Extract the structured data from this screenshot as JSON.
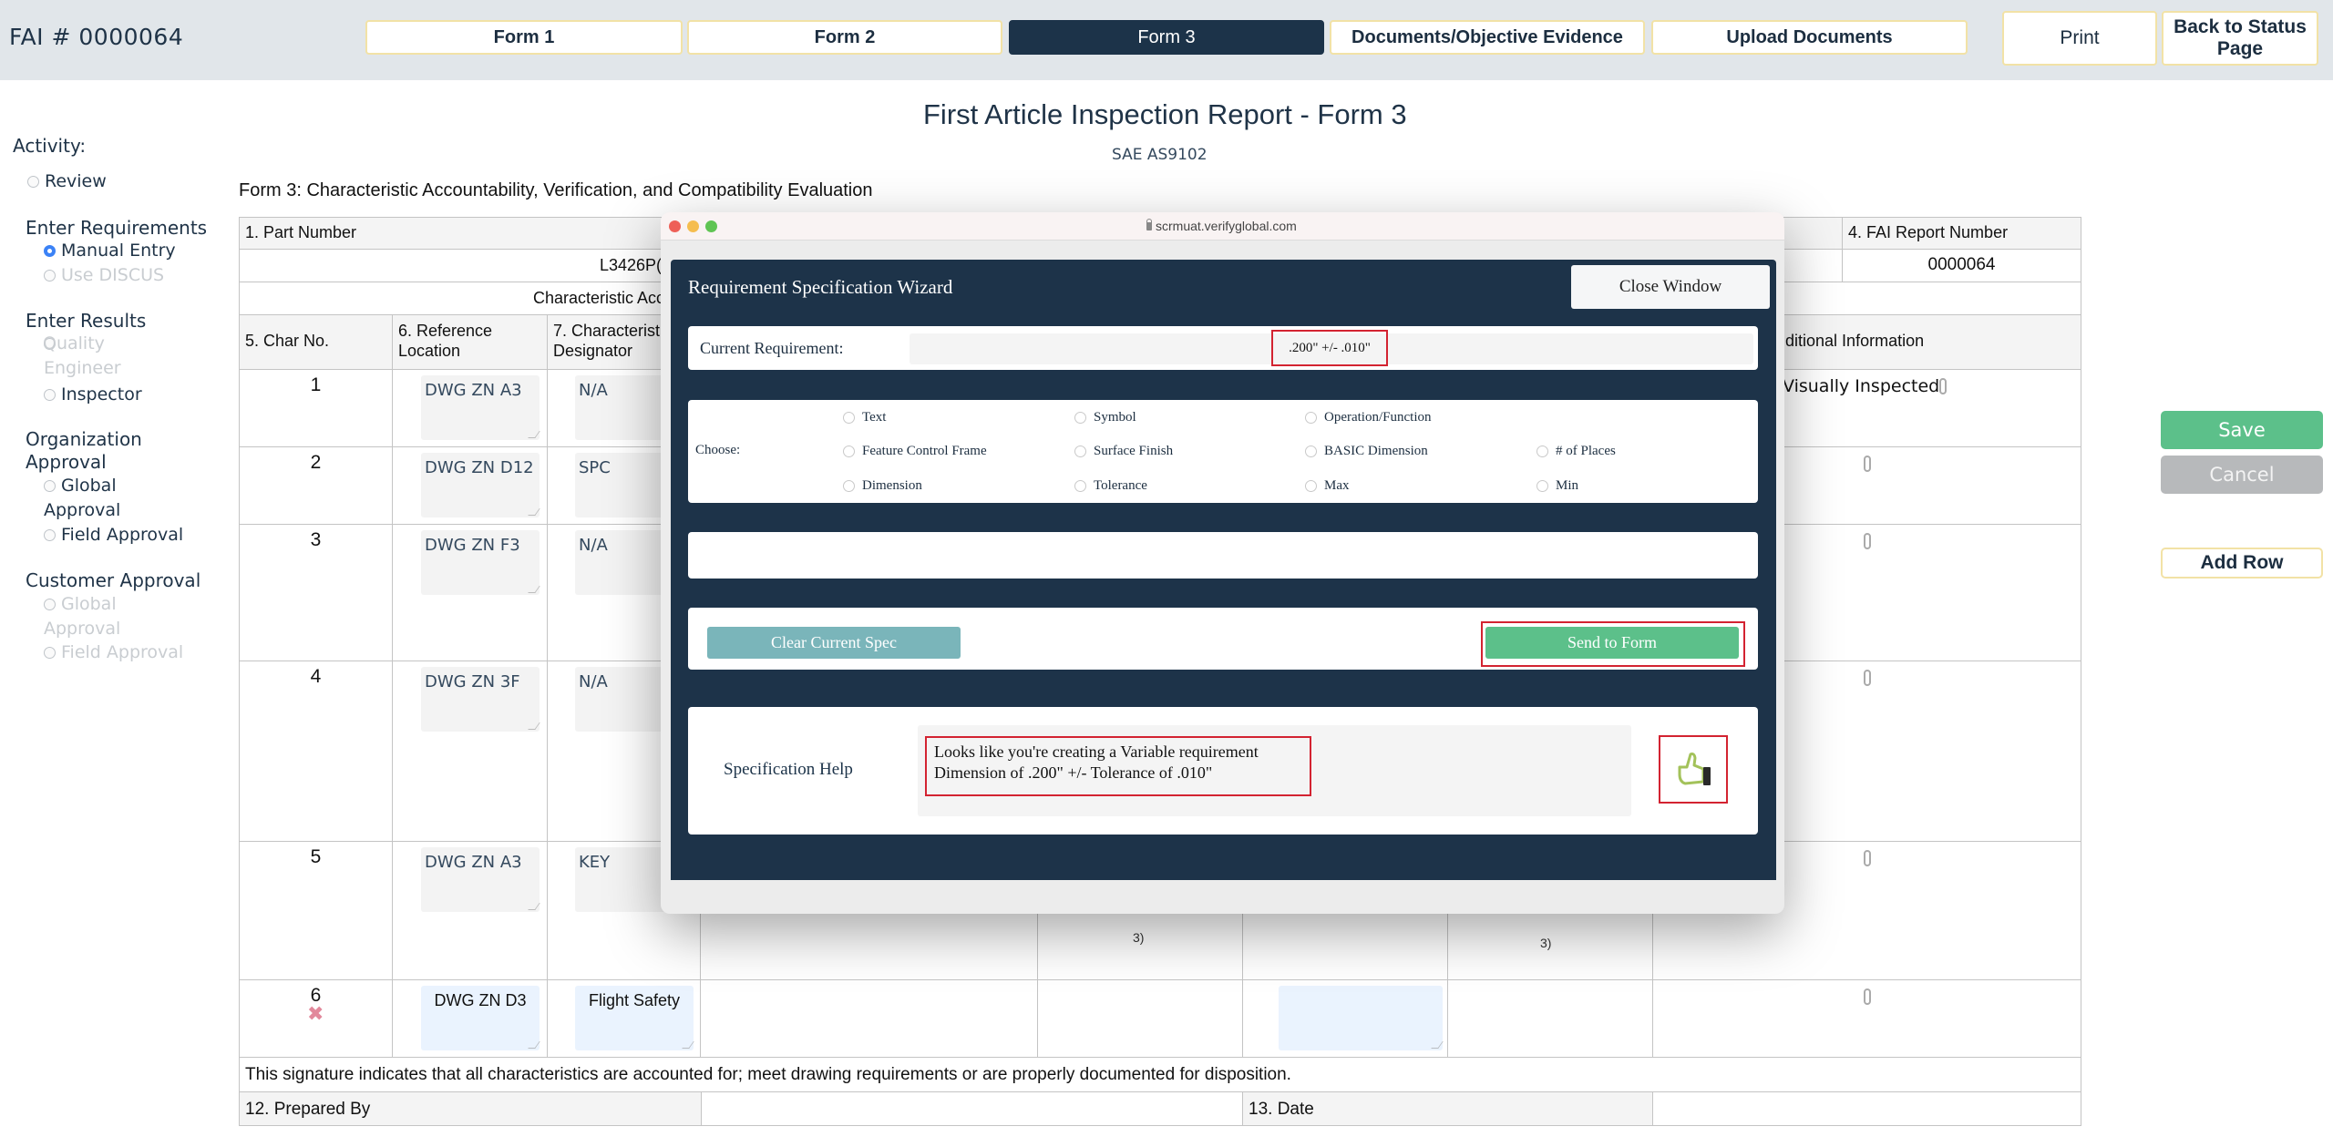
{
  "header": {
    "fai_title": "FAI # 0000064",
    "tabs": [
      {
        "label": "Form 1",
        "active": false
      },
      {
        "label": "Form 2",
        "active": false
      },
      {
        "label": "Form 3",
        "active": true
      },
      {
        "label": "Documents/Objective Evidence",
        "active": false
      },
      {
        "label": "Upload Documents",
        "active": false
      }
    ],
    "print_label": "Print",
    "back_label": "Back to Status Page"
  },
  "page": {
    "title": "First Article Inspection Report - Form 3",
    "subtitle": "SAE AS9102",
    "form_subtitle": "Form 3: Characteristic Accountability, Verification, and Compatibility Evaluation"
  },
  "left_panel": {
    "activity_label": "Activity:",
    "review_label": "Review",
    "enter_requirements": {
      "heading": "Enter Requirements",
      "options": [
        {
          "label": "Manual Entry",
          "selected": true,
          "disabled": false
        },
        {
          "label": "Use DISCUS",
          "selected": false,
          "disabled": true
        }
      ]
    },
    "enter_results": {
      "heading": "Enter Results",
      "options": [
        {
          "label": "Quality Engineer",
          "selected": false,
          "disabled": true
        },
        {
          "label": "Inspector",
          "selected": false,
          "disabled": false
        }
      ]
    },
    "organization_approval": {
      "heading": "Organization Approval",
      "options": [
        {
          "label": "Global Approval",
          "selected": false,
          "disabled": false
        },
        {
          "label": "Field Approval",
          "selected": false,
          "disabled": false
        }
      ]
    },
    "customer_approval": {
      "heading": "Customer Approval",
      "options": [
        {
          "label": "Global Approval",
          "selected": false,
          "disabled": true
        },
        {
          "label": "Field Approval",
          "selected": false,
          "disabled": true
        }
      ]
    }
  },
  "table": {
    "part_number_label": "1. Part Number",
    "part_number_value": "L3426P(",
    "fai_report_label": "4. FAI Report Number",
    "fai_report_value": "0000064",
    "accountability_label": "Characteristic Acc",
    "col_char_no": "5. Char No.",
    "col_ref_location": "6. Reference Location",
    "col_designator": "7. Characterist Designator",
    "col_additional": "dditional Information",
    "rows": [
      {
        "char_no": "1",
        "ref_location": "DWG ZN A3",
        "designator": "N/A",
        "additional": "Visually Inspected"
      },
      {
        "char_no": "2",
        "ref_location": "DWG ZN D12",
        "designator": "SPC",
        "additional": ""
      },
      {
        "char_no": "3",
        "ref_location": "DWG ZN F3",
        "designator": "N/A",
        "additional": ""
      },
      {
        "char_no": "4",
        "ref_location": "DWG ZN 3F",
        "designator": "N/A",
        "additional": ""
      },
      {
        "char_no": "5",
        "ref_location": "DWG ZN A3",
        "designator": "KEY",
        "additional": "",
        "note_a": "3)",
        "note_b": "3)"
      },
      {
        "char_no": "6",
        "ref_location": "DWG ZN D3",
        "designator": "Flight Safety",
        "additional": ""
      }
    ],
    "signature_text": "This signature indicates that all characteristics are accounted for; meet drawing requirements or are properly documented for disposition.",
    "prepared_by_label": "12. Prepared By",
    "date_label": "13. Date"
  },
  "actions": {
    "save_label": "Save",
    "cancel_label": "Cancel",
    "add_row_label": "Add Row"
  },
  "modal": {
    "url": "scrmuat.verifyglobal.com",
    "title": "Requirement Specification Wizard",
    "close_label": "Close Window",
    "current_requirement_label": "Current Requirement:",
    "current_requirement_value": ".200\"  +/-  .010\"",
    "choose_label": "Choose:",
    "options": [
      {
        "label": "Text"
      },
      {
        "label": "Symbol"
      },
      {
        "label": "Operation/Function"
      },
      {
        "label": "Feature Control Frame"
      },
      {
        "label": "Surface Finish"
      },
      {
        "label": "BASIC Dimension"
      },
      {
        "label": "# of Places"
      },
      {
        "label": "Dimension"
      },
      {
        "label": "Tolerance"
      },
      {
        "label": "Max"
      },
      {
        "label": "Min"
      }
    ],
    "clear_label": "Clear Current Spec",
    "send_label": "Send to Form",
    "help_label": "Specification Help",
    "help_line1": "Looks like you're creating a Variable requirement",
    "help_line2": "Dimension of .200\" +/- Tolerance of .010\"",
    "colors": {
      "navy": "#1d3349",
      "green": "#5cc08a",
      "teal": "#7ab5ba",
      "highlight": "#d32331"
    }
  }
}
